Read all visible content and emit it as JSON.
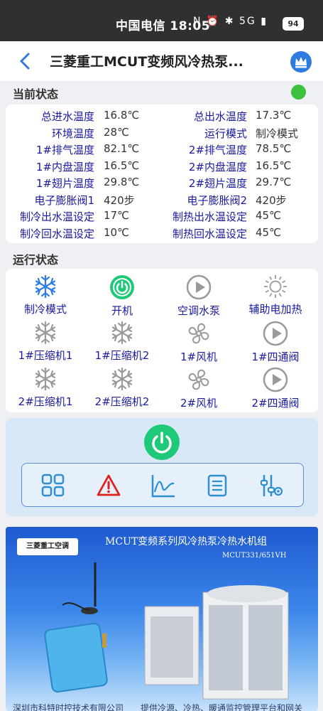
{
  "status_bar": {
    "carrier_time": "中国电信 18:05",
    "icons": "N ⏰ ✱ 5G ▮",
    "battery": "94"
  },
  "header": {
    "title": "三菱重工MCUT变频风冷热泵...",
    "icons": [
      "back-arrow-icon",
      "crown-icon"
    ]
  },
  "current_status": {
    "title": "当前状态",
    "indicator_color": "#3cc23c",
    "rows": [
      [
        {
          "label": "总进水温度",
          "value": "16.8℃"
        },
        {
          "label": "总出水温度",
          "value": "17.3℃"
        }
      ],
      [
        {
          "label": "环境温度",
          "value": "28℃"
        },
        {
          "label": "运行模式",
          "value": "制冷模式"
        }
      ],
      [
        {
          "label": "1#排气温度",
          "value": "82.1℃"
        },
        {
          "label": "2#排气温度",
          "value": "78.5℃"
        }
      ],
      [
        {
          "label": "1#内盘温度",
          "value": "16.5℃"
        },
        {
          "label": "2#内盘温度",
          "value": "16.5℃"
        }
      ],
      [
        {
          "label": "1#翅片温度",
          "value": "29.8℃"
        },
        {
          "label": "2#翅片温度",
          "value": "29.7℃"
        }
      ],
      [
        {
          "label": "电子膨胀阀1",
          "value": "420步"
        },
        {
          "label": "电子膨胀阀2",
          "value": "420步"
        }
      ],
      [
        {
          "label": "制冷出水温设定",
          "value": "17℃"
        },
        {
          "label": "制热出水温设定",
          "value": "45℃"
        }
      ],
      [
        {
          "label": "制冷回水温设定",
          "value": "10℃"
        },
        {
          "label": "制热回水温设定",
          "value": "45℃"
        }
      ]
    ]
  },
  "run_status": {
    "title": "运行状态",
    "items": [
      {
        "label": "制冷模式",
        "icon": "snowflake-icon",
        "active": true
      },
      {
        "label": "开机",
        "icon": "power-icon",
        "active": true
      },
      {
        "label": "空调水泵",
        "icon": "play-icon",
        "active": false
      },
      {
        "label": "辅助电加热",
        "icon": "sun-icon",
        "active": false
      },
      {
        "label": "1#压缩机1",
        "icon": "snowflake-icon",
        "active": false
      },
      {
        "label": "1#压缩机2",
        "icon": "snowflake-icon",
        "active": false
      },
      {
        "label": "1#风机",
        "icon": "fan-icon",
        "active": false
      },
      {
        "label": "1#四通阀",
        "icon": "play-icon",
        "active": false
      },
      {
        "label": "2#压缩机1",
        "icon": "snowflake-icon",
        "active": false
      },
      {
        "label": "2#压缩机2",
        "icon": "snowflake-icon",
        "active": false
      },
      {
        "label": "2#风机",
        "icon": "fan-icon",
        "active": false
      },
      {
        "label": "2#四通阀",
        "icon": "play-icon",
        "active": false
      }
    ]
  },
  "control_panel": {
    "power_icon": "power-icon",
    "tools": [
      "grid-icon",
      "warning-icon",
      "chart-icon",
      "list-icon",
      "settings-sliders-icon"
    ]
  },
  "banner": {
    "brand": "三菱重工空调",
    "title": "MCUT变频系列风冷热泵冷热水机组",
    "model": "MCUT331/651VH",
    "footer": "深圳市科特时控技术有限公司　　提供冷源、冷热、暖通监控管理平台和网关"
  },
  "colors": {
    "label_blue": "#1a1aa0",
    "active_green": "#1ec97a",
    "icon_blue": "#2f7ce0",
    "inactive_gray": "#9a9a9a"
  }
}
